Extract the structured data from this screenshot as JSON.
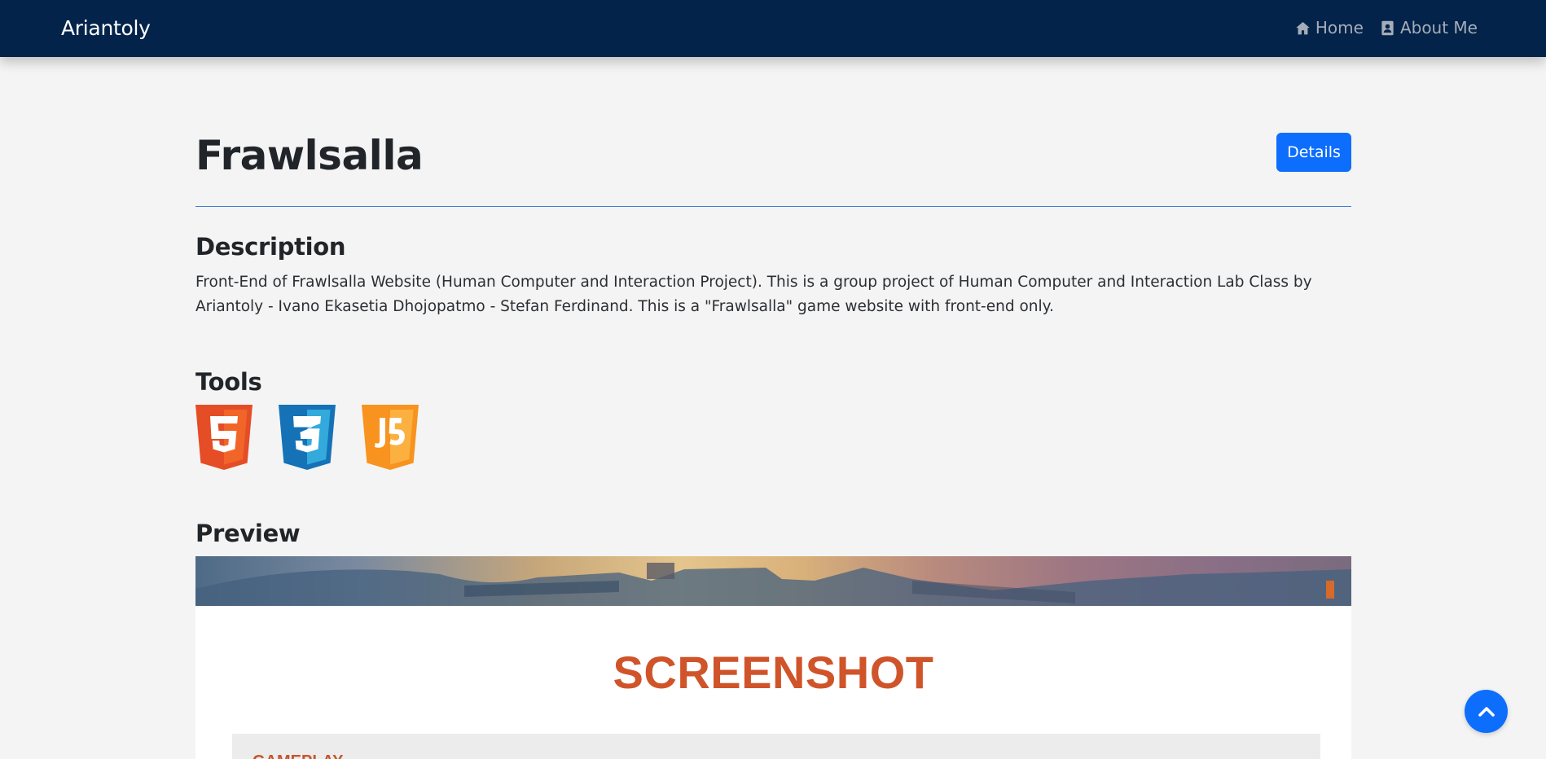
{
  "navbar": {
    "brand": "Ariantoly",
    "links": [
      {
        "label": "Home",
        "icon": "home-icon"
      },
      {
        "label": "About Me",
        "icon": "user-card-icon"
      }
    ]
  },
  "project": {
    "title": "Frawlsalla",
    "details_label": "Details"
  },
  "description": {
    "heading": "Description",
    "text": "Front-End of Frawlsalla Website (Human Computer and Interaction Project). This is a group project of Human Computer and Interaction Lab Class by Ariantoly - Ivano Ekasetia Dhojopatmo - Stefan Ferdinand. This is a \"Frawlsalla\" game website with front-end only."
  },
  "tools": {
    "heading": "Tools",
    "items": [
      {
        "icon": "html5-icon",
        "color": "#e44d26"
      },
      {
        "icon": "css3-icon",
        "color": "#1572b6"
      },
      {
        "icon": "javascript-icon",
        "color": "#f7931e"
      }
    ]
  },
  "preview": {
    "heading": "Preview",
    "screenshot_title": "SCREENSHOT",
    "gameplay_label": "GAMEPLAY"
  },
  "colors": {
    "navbar_bg": "#03234a",
    "primary": "#0d6efd",
    "accent_orange": "#d0542a"
  }
}
